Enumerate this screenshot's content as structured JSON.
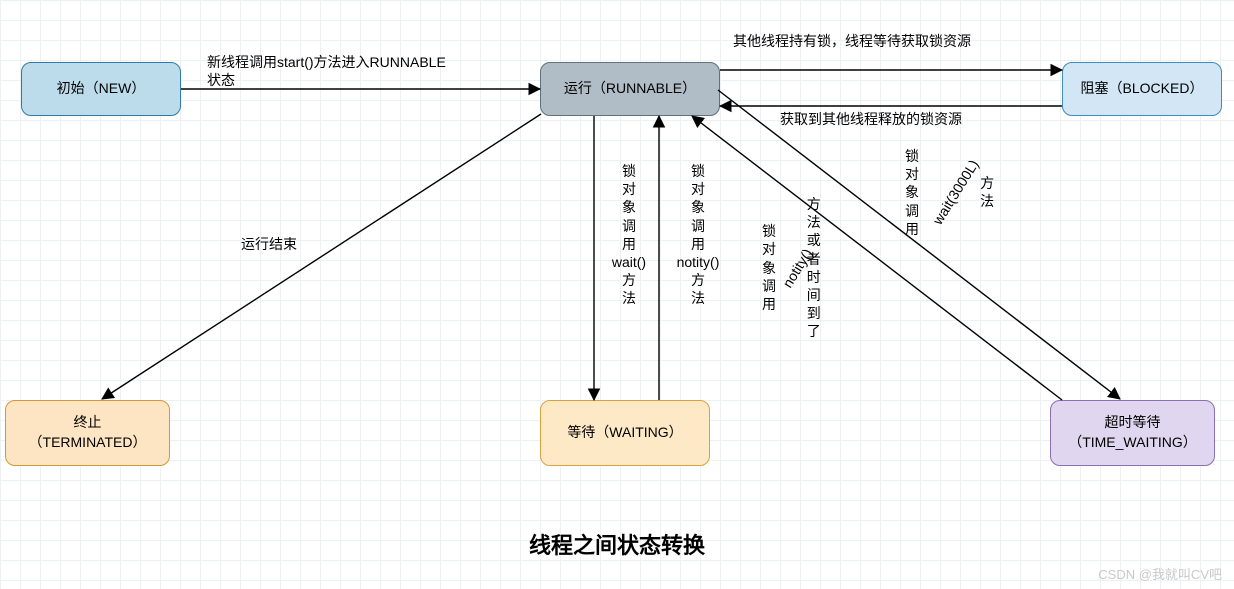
{
  "title": "线程之间状态转换",
  "watermark": "CSDN @我就叫CV吧",
  "states": {
    "new": "初始（NEW）",
    "runnable": "运行（RUNNABLE）",
    "blocked": "阻塞（BLOCKED）",
    "terminated_l1": "终止",
    "terminated_l2": "（TERMINATED）",
    "waiting": "等待（WAITING）",
    "timewaiting_l1": "超时等待",
    "timewaiting_l2": "（TIME_WAITING）"
  },
  "edges": {
    "new_to_run_l1": "新线程调用start()方法进入RUNNABLE",
    "new_to_run_l2": "状态",
    "run_to_blocked": "其他线程持有锁，线程等待获取锁资源",
    "blocked_to_run": "获取到其他线程释放的锁资源",
    "run_to_term": "运行结束",
    "run_to_wait_v1": "锁",
    "run_to_wait_v2": "对",
    "run_to_wait_v3": "象",
    "run_to_wait_v4": "调",
    "run_to_wait_v5": "用",
    "run_to_wait_v6": "wait()",
    "run_to_wait_v7": "方",
    "run_to_wait_v8": "法",
    "wait_to_run_v1": "锁",
    "wait_to_run_v2": "对",
    "wait_to_run_v3": "象",
    "wait_to_run_v4": "调",
    "wait_to_run_v5": "用",
    "wait_to_run_v6": "notity()",
    "wait_to_run_v7": "方",
    "wait_to_run_v8": "法",
    "time_to_run_v1": "锁",
    "time_to_run_v2": "对",
    "time_to_run_v3": "象",
    "time_to_run_v4": "调",
    "time_to_run_v5": "用",
    "time_to_run_v6a": "notity()",
    "time_to_run_v7": "方",
    "time_to_run_v8": "法",
    "time_to_run_v9": "或",
    "time_to_run_v10": "者",
    "time_to_run_v11": "时",
    "time_to_run_v12": "间",
    "time_to_run_v13": "到",
    "time_to_run_v14": "了",
    "run_to_time_v1": "锁",
    "run_to_time_v2": "对",
    "run_to_time_v3": "象",
    "run_to_time_v4": "调",
    "run_to_time_v5": "用",
    "run_to_time_v6a": "wait(3000L)",
    "run_to_time_v7": "方",
    "run_to_time_v8": "法"
  }
}
